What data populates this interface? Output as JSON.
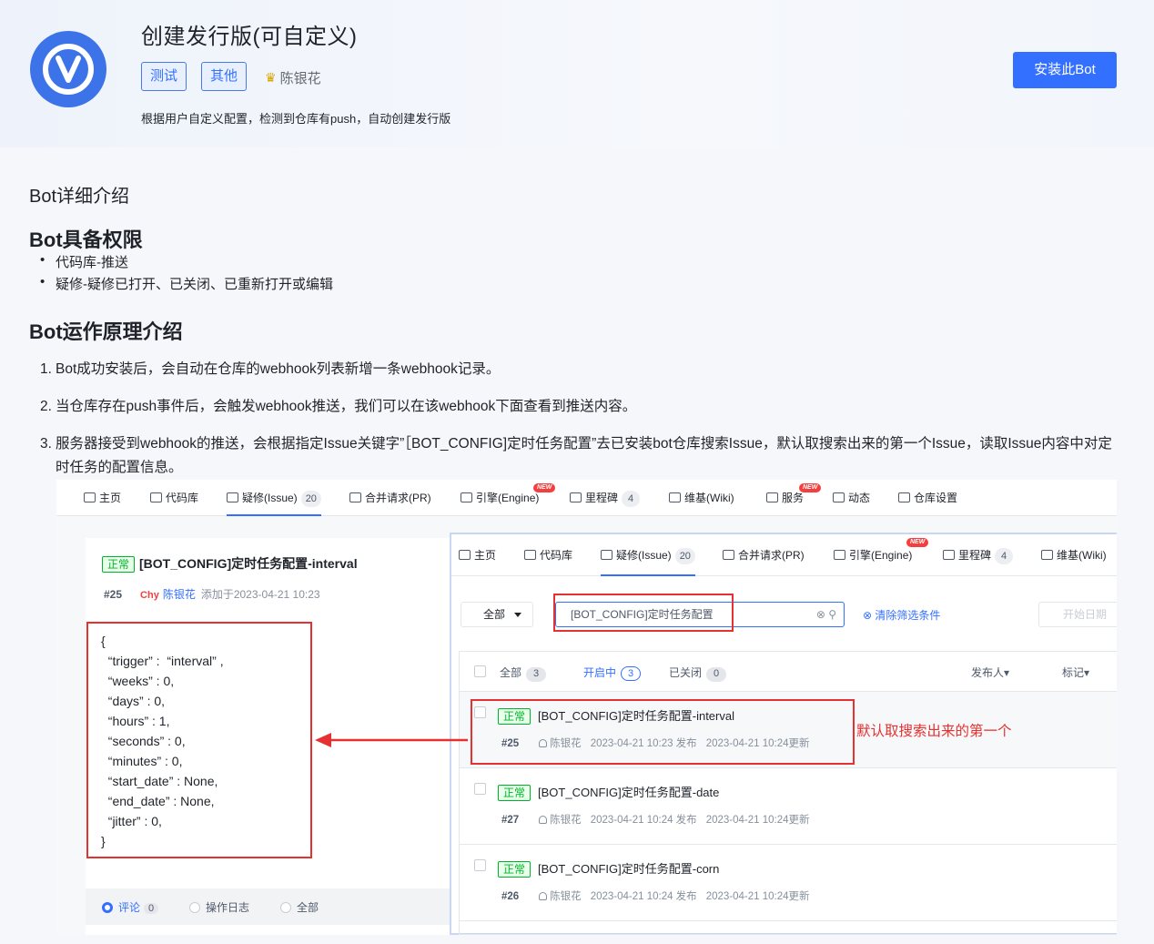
{
  "header": {
    "title": "创建发行版(可自定义)",
    "tags": [
      "测试",
      "其他"
    ],
    "author": "陈银花",
    "description": "根据用户自定义配置，检测到仓库有push，自动创建发行版",
    "install_label": "安装此Bot",
    "accent": "#3370ff"
  },
  "content": {
    "section_title": "Bot详细介绍",
    "permissions_title": "Bot具备权限",
    "permissions": [
      "代码库-推送",
      "疑修-疑修已打开、已关闭、已重新打开或编辑"
    ],
    "principle_title": "Bot运作原理介绍",
    "steps": [
      {
        "num": "1.",
        "text": "Bot成功安装后，会自动在仓库的webhook列表新增一条webhook记录。"
      },
      {
        "num": "2.",
        "text": "当仓库存在push事件后，会触发webhook推送，我们可以在该webhook下面查看到推送内容。"
      },
      {
        "num": "3.",
        "text": "服务器接受到webhook的推送，会根据指定Issue关键字”［BOT_CONFIG]定时任务配置”去已安装bot仓库搜索Issue，默认取搜索出来的第一个Issue，读取Issue内容中对定时任务的配置信息。"
      }
    ]
  },
  "screenshot": {
    "nav": [
      {
        "label": "主页"
      },
      {
        "label": "代码库"
      },
      {
        "label": "疑修(Issue)",
        "badge": "20"
      },
      {
        "label": "合并请求(PR)"
      },
      {
        "label": "引擎(Engine)",
        "new": "NEW"
      },
      {
        "label": "里程碑",
        "badge": "4"
      },
      {
        "label": "维基(Wiki)"
      },
      {
        "label": "服务",
        "new": "NEW"
      },
      {
        "label": "动态"
      },
      {
        "label": "仓库设置"
      }
    ],
    "issue": {
      "status": "正常",
      "title": "[BOT_CONFIG]定时任务配置-interval",
      "number": "#25",
      "avatar_text": "Chy",
      "user": "陈银花",
      "added": "添加于2023-04-21 10:23"
    },
    "code_lines": [
      "{",
      "  “trigger” :  “interval” ,",
      "  “weeks” : 0,",
      "  “days” : 0,",
      "  “hours” : 1,",
      "  “seconds” : 0,",
      "  “minutes” : 0,",
      "  “start_date” : None,",
      "  “end_date” : None,",
      "  “jitter” : 0,",
      "}"
    ],
    "comment_tabs": [
      {
        "label": "评论",
        "count": "0"
      },
      {
        "label": "操作日志"
      },
      {
        "label": "全部"
      }
    ],
    "right_nav": [
      {
        "label": "主页"
      },
      {
        "label": "代码库"
      },
      {
        "label": "疑修(Issue)",
        "badge": "20"
      },
      {
        "label": "合并请求(PR)"
      },
      {
        "label": "引擎(Engine)",
        "new": "NEW"
      },
      {
        "label": "里程碑",
        "badge": "4"
      },
      {
        "label": "维基(Wiki)"
      }
    ],
    "filter": {
      "select_label": "全部",
      "search_value": "[BOT_CONFIG]定时任务配置",
      "clear_label": "清除筛选条件",
      "date_placeholder": "开始日期"
    },
    "list_head": {
      "all": "全部",
      "all_count": "3",
      "open": "开启中",
      "open_count": "3",
      "closed": "已关闭",
      "closed_count": "0",
      "publisher": "发布人▾",
      "tag": "标记▾"
    },
    "rows": [
      {
        "status": "正常",
        "title": "[BOT_CONFIG]定时任务配置-interval",
        "number": "#25",
        "user": "陈银花",
        "published": "2023-04-21 10:23 发布",
        "updated": "2023-04-21 10:24更新"
      },
      {
        "status": "正常",
        "title": "[BOT_CONFIG]定时任务配置-date",
        "number": "#27",
        "user": "陈银花",
        "published": "2023-04-21 10:24 发布",
        "updated": "2023-04-21 10:24更新"
      },
      {
        "status": "正常",
        "title": "[BOT_CONFIG]定时任务配置-corn",
        "number": "#26",
        "user": "陈银花",
        "published": "2023-04-21 10:24 发布",
        "updated": "2023-04-21 10:24更新"
      }
    ],
    "callout": "默认取搜索出来的第一个"
  }
}
